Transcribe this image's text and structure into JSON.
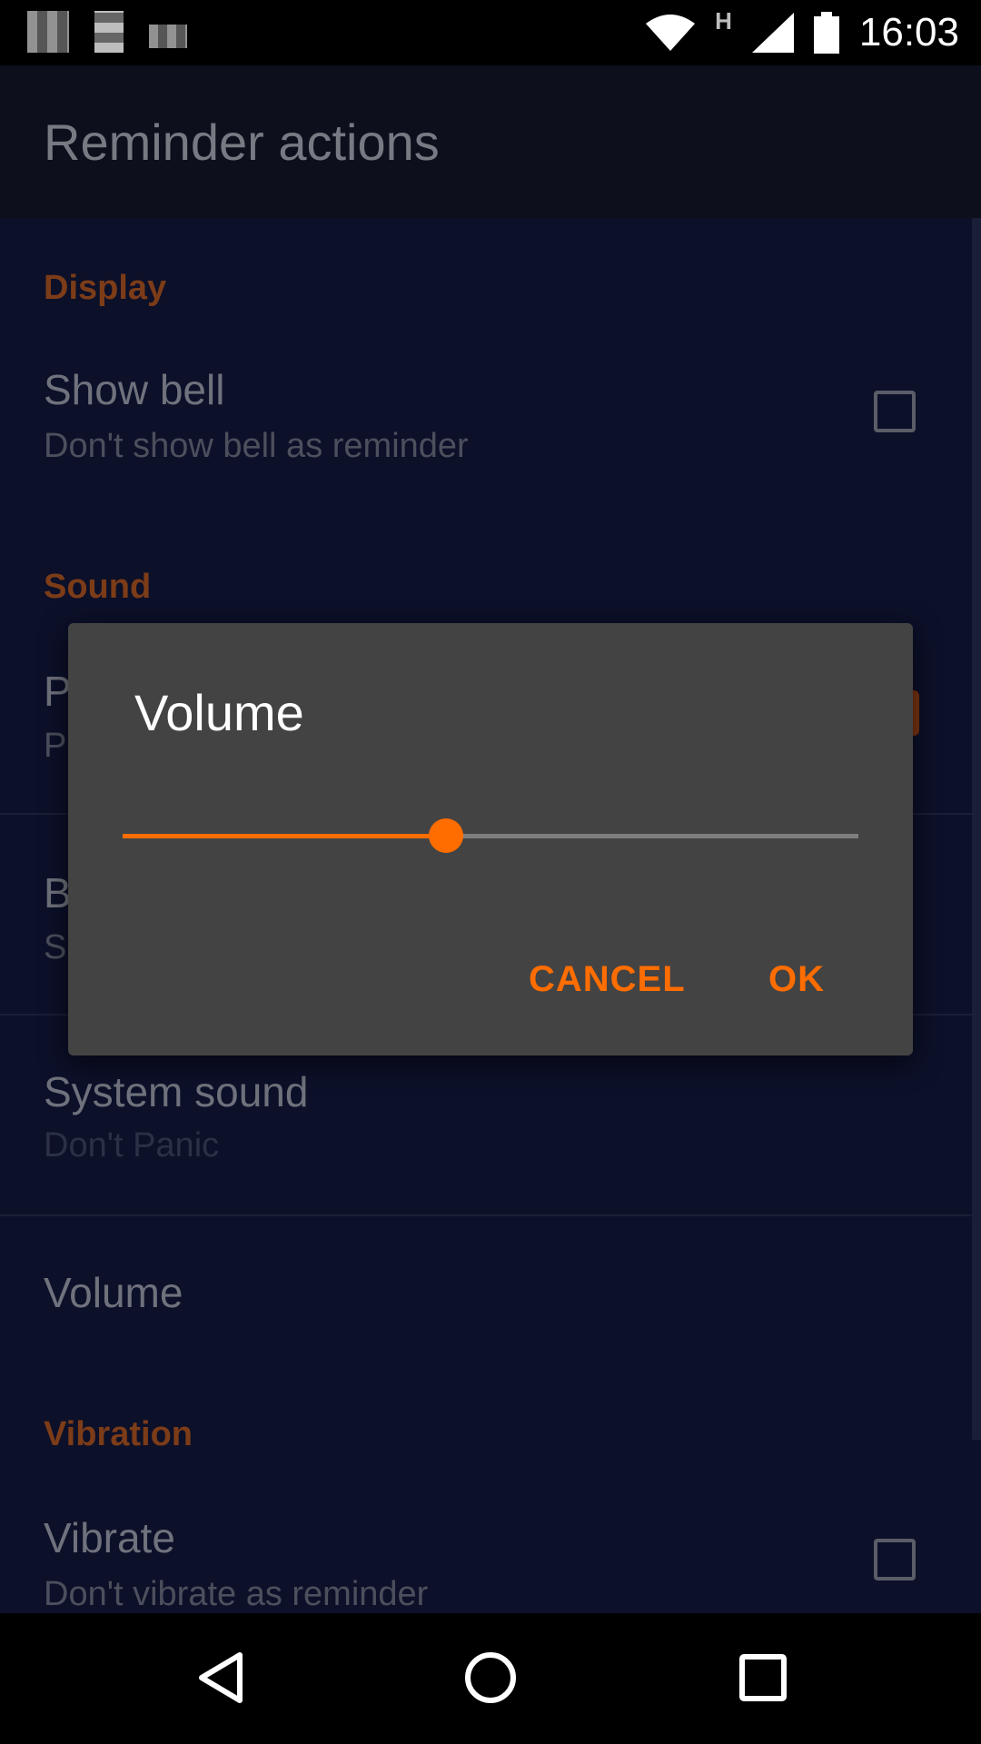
{
  "status_bar": {
    "time": "16:03",
    "network_type": "H",
    "icons": [
      "notification-icon",
      "notification-icon",
      "notification-icon",
      "wifi-icon",
      "signal-icon",
      "battery-icon"
    ]
  },
  "app_bar": {
    "title": "Reminder actions"
  },
  "sections": {
    "display": {
      "header": "Display",
      "show_bell": {
        "title": "Show bell",
        "subtitle": "Don't show bell as reminder",
        "checked": false
      }
    },
    "sound": {
      "header": "Sound",
      "partial_row_1_title": "P",
      "partial_row_1_sub": "P",
      "partial_row_2_title": "B",
      "partial_row_2_sub": "S",
      "system_sound": {
        "title": "System sound",
        "subtitle": "Don't Panic"
      },
      "volume": {
        "title": "Volume"
      }
    },
    "vibration": {
      "header": "Vibration",
      "vibrate": {
        "title": "Vibrate",
        "subtitle": "Don't vibrate as reminder",
        "checked": false
      }
    }
  },
  "dialog": {
    "title": "Volume",
    "slider_value": 0.44,
    "cancel_label": "CANCEL",
    "ok_label": "OK"
  },
  "colors": {
    "accent": "#ff6d00",
    "section_header": "#7c3c18",
    "background": "#0c1029",
    "dialog_bg": "#434343"
  },
  "nav_bar": {
    "icons": [
      "back-icon",
      "home-icon",
      "recents-icon"
    ]
  }
}
